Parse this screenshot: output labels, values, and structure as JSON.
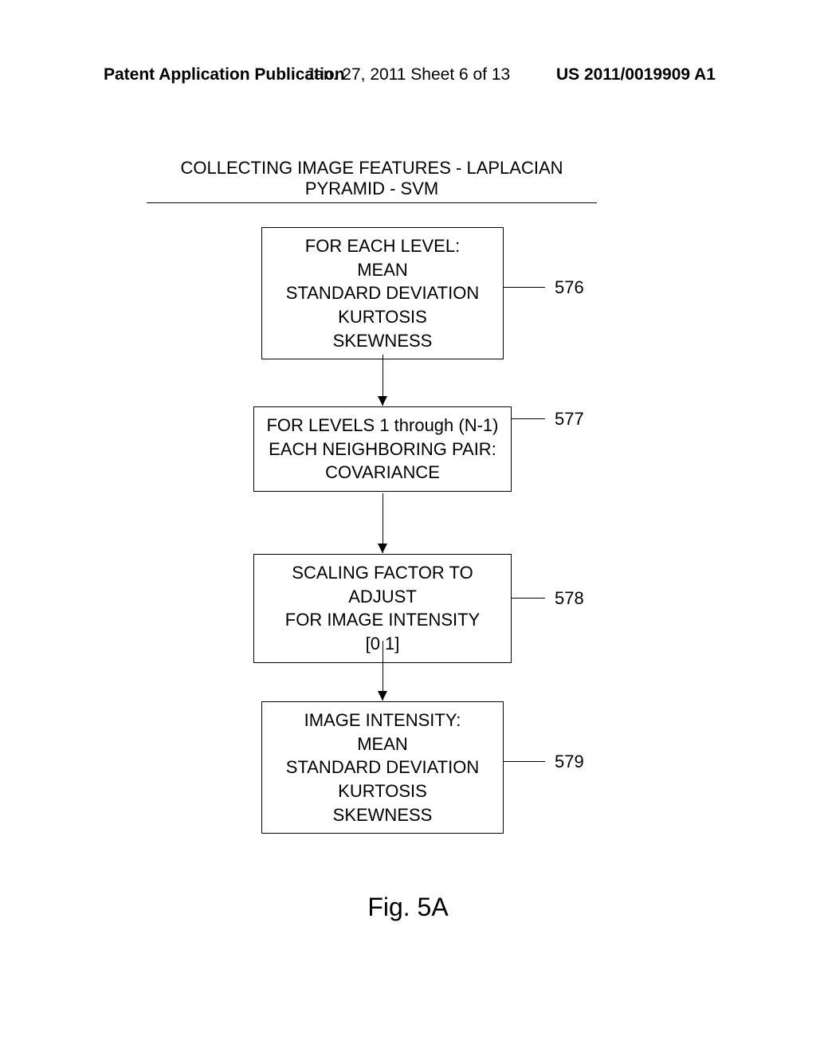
{
  "header": {
    "left": "Patent Application Publication",
    "center": "Jan. 27, 2011  Sheet 6 of 13",
    "right": "US 2011/0019909 A1"
  },
  "title": "COLLECTING IMAGE FEATURES - LAPLACIAN PYRAMID - SVM",
  "boxes": {
    "box1": {
      "lines": [
        "FOR EACH LEVEL:",
        "MEAN",
        "STANDARD DEVIATION",
        "KURTOSIS",
        "SKEWNESS"
      ],
      "ref": "576"
    },
    "box2": {
      "lines": [
        "FOR LEVELS 1 through (N-1)",
        "EACH NEIGHBORING PAIR:",
        "COVARIANCE"
      ],
      "ref": "577"
    },
    "box3": {
      "lines": [
        "SCALING FACTOR TO ADJUST",
        "FOR IMAGE INTENSITY",
        "[0 1]"
      ],
      "ref": "578"
    },
    "box4": {
      "lines": [
        "IMAGE INTENSITY:",
        "MEAN",
        "STANDARD DEVIATION",
        "KURTOSIS",
        "SKEWNESS"
      ],
      "ref": "579"
    }
  },
  "figure_label": "Fig. 5A",
  "chart_data": {
    "type": "flowchart",
    "nodes": [
      {
        "id": "576",
        "text": "FOR EACH LEVEL: MEAN STANDARD DEVIATION KURTOSIS SKEWNESS"
      },
      {
        "id": "577",
        "text": "FOR LEVELS 1 through (N-1) EACH NEIGHBORING PAIR: COVARIANCE"
      },
      {
        "id": "578",
        "text": "SCALING FACTOR TO ADJUST FOR IMAGE INTENSITY [0 1]"
      },
      {
        "id": "579",
        "text": "IMAGE INTENSITY: MEAN STANDARD DEVIATION KURTOSIS SKEWNESS"
      }
    ],
    "edges": [
      {
        "from": "576",
        "to": "577"
      },
      {
        "from": "577",
        "to": "578"
      },
      {
        "from": "578",
        "to": "579"
      }
    ],
    "title": "COLLECTING IMAGE FEATURES - LAPLACIAN PYRAMID - SVM"
  }
}
